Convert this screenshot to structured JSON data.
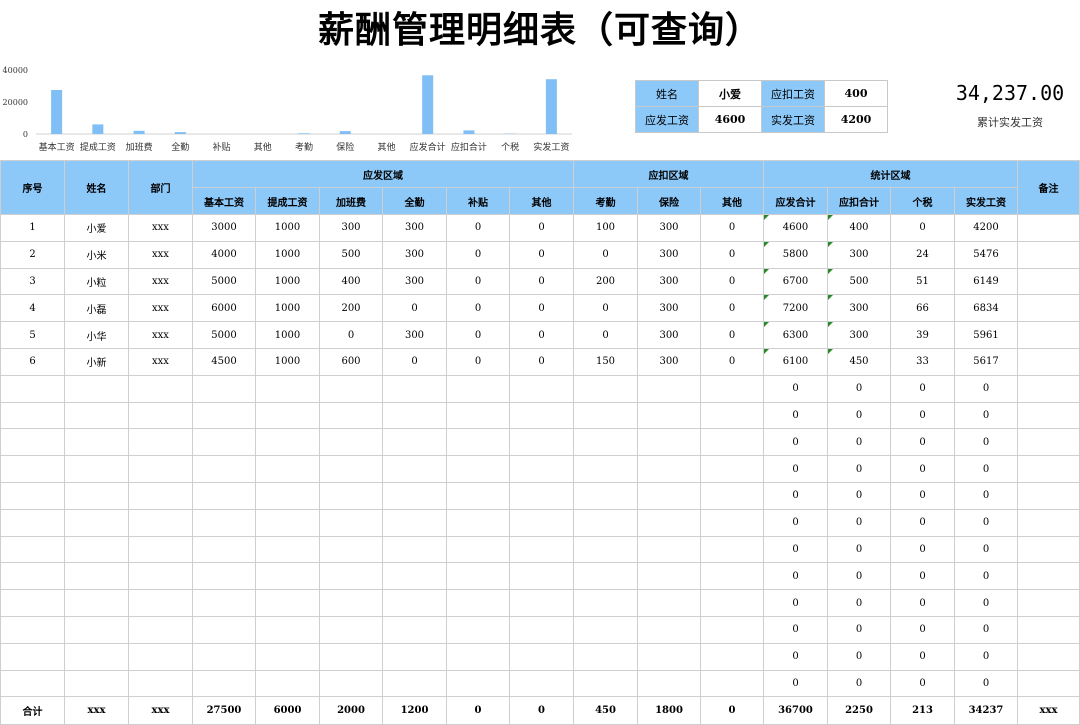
{
  "title": "薪酬管理明细表（可查询）",
  "chart_data": {
    "type": "bar",
    "categories": [
      "基本工资",
      "提成工资",
      "加班费",
      "全勤",
      "补贴",
      "其他",
      "考勤",
      "保险",
      "其他",
      "应发合计",
      "应扣合计",
      "个税",
      "实发工资"
    ],
    "values": [
      27500,
      6000,
      2000,
      1200,
      0,
      0,
      450,
      1800,
      0,
      36700,
      2250,
      213,
      34237
    ],
    "yticks": [
      "0",
      "20000",
      "40000"
    ],
    "ylim": [
      0,
      40000
    ],
    "color": "#7fbff5"
  },
  "lookup": {
    "name_label": "姓名",
    "name_value": "小爱",
    "deduct_label": "应扣工资",
    "deduct_value": "400",
    "gross_label": "应发工资",
    "gross_value": "4600",
    "net_label": "实发工资",
    "net_value": "4200"
  },
  "summary": {
    "amount": "34,237.00",
    "caption": "累计实发工资"
  },
  "table": {
    "headers": {
      "seq": "序号",
      "name": "姓名",
      "dept": "部门",
      "group_pay": "应发区域",
      "group_deduct": "应扣区域",
      "group_stats": "统计区域",
      "remark": "备注",
      "cols": [
        "基本工资",
        "提成工资",
        "加班费",
        "全勤",
        "补贴",
        "其他",
        "考勤",
        "保险",
        "其他",
        "应发合计",
        "应扣合计",
        "个税",
        "实发工资"
      ]
    },
    "rows": [
      [
        "1",
        "小爱",
        "xxx",
        "3000",
        "1000",
        "300",
        "300",
        "0",
        "0",
        "100",
        "300",
        "0",
        "4600",
        "400",
        "0",
        "4200",
        ""
      ],
      [
        "2",
        "小米",
        "xxx",
        "4000",
        "1000",
        "500",
        "300",
        "0",
        "0",
        "0",
        "300",
        "0",
        "5800",
        "300",
        "24",
        "5476",
        ""
      ],
      [
        "3",
        "小粒",
        "xxx",
        "5000",
        "1000",
        "400",
        "300",
        "0",
        "0",
        "200",
        "300",
        "0",
        "6700",
        "500",
        "51",
        "6149",
        ""
      ],
      [
        "4",
        "小磊",
        "xxx",
        "6000",
        "1000",
        "200",
        "0",
        "0",
        "0",
        "0",
        "300",
        "0",
        "7200",
        "300",
        "66",
        "6834",
        ""
      ],
      [
        "5",
        "小华",
        "xxx",
        "5000",
        "1000",
        "0",
        "300",
        "0",
        "0",
        "0",
        "300",
        "0",
        "6300",
        "300",
        "39",
        "5961",
        ""
      ],
      [
        "6",
        "小新",
        "xxx",
        "4500",
        "1000",
        "600",
        "0",
        "0",
        "0",
        "150",
        "300",
        "0",
        "6100",
        "450",
        "33",
        "5617",
        ""
      ],
      [
        "",
        "",
        "",
        "",
        "",
        "",
        "",
        "",
        "",
        "",
        "",
        "",
        "0",
        "0",
        "0",
        "0",
        ""
      ],
      [
        "",
        "",
        "",
        "",
        "",
        "",
        "",
        "",
        "",
        "",
        "",
        "",
        "0",
        "0",
        "0",
        "0",
        ""
      ],
      [
        "",
        "",
        "",
        "",
        "",
        "",
        "",
        "",
        "",
        "",
        "",
        "",
        "0",
        "0",
        "0",
        "0",
        ""
      ],
      [
        "",
        "",
        "",
        "",
        "",
        "",
        "",
        "",
        "",
        "",
        "",
        "",
        "0",
        "0",
        "0",
        "0",
        ""
      ],
      [
        "",
        "",
        "",
        "",
        "",
        "",
        "",
        "",
        "",
        "",
        "",
        "",
        "0",
        "0",
        "0",
        "0",
        ""
      ],
      [
        "",
        "",
        "",
        "",
        "",
        "",
        "",
        "",
        "",
        "",
        "",
        "",
        "0",
        "0",
        "0",
        "0",
        ""
      ],
      [
        "",
        "",
        "",
        "",
        "",
        "",
        "",
        "",
        "",
        "",
        "",
        "",
        "0",
        "0",
        "0",
        "0",
        ""
      ],
      [
        "",
        "",
        "",
        "",
        "",
        "",
        "",
        "",
        "",
        "",
        "",
        "",
        "0",
        "0",
        "0",
        "0",
        ""
      ],
      [
        "",
        "",
        "",
        "",
        "",
        "",
        "",
        "",
        "",
        "",
        "",
        "",
        "0",
        "0",
        "0",
        "0",
        ""
      ],
      [
        "",
        "",
        "",
        "",
        "",
        "",
        "",
        "",
        "",
        "",
        "",
        "",
        "0",
        "0",
        "0",
        "0",
        ""
      ],
      [
        "",
        "",
        "",
        "",
        "",
        "",
        "",
        "",
        "",
        "",
        "",
        "",
        "0",
        "0",
        "0",
        "0",
        ""
      ],
      [
        "",
        "",
        "",
        "",
        "",
        "",
        "",
        "",
        "",
        "",
        "",
        "",
        "0",
        "0",
        "0",
        "0",
        ""
      ]
    ],
    "totals": [
      "合计",
      "xxx",
      "xxx",
      "27500",
      "6000",
      "2000",
      "1200",
      "0",
      "0",
      "450",
      "1800",
      "0",
      "36700",
      "2250",
      "213",
      "34237",
      "xxx"
    ]
  }
}
